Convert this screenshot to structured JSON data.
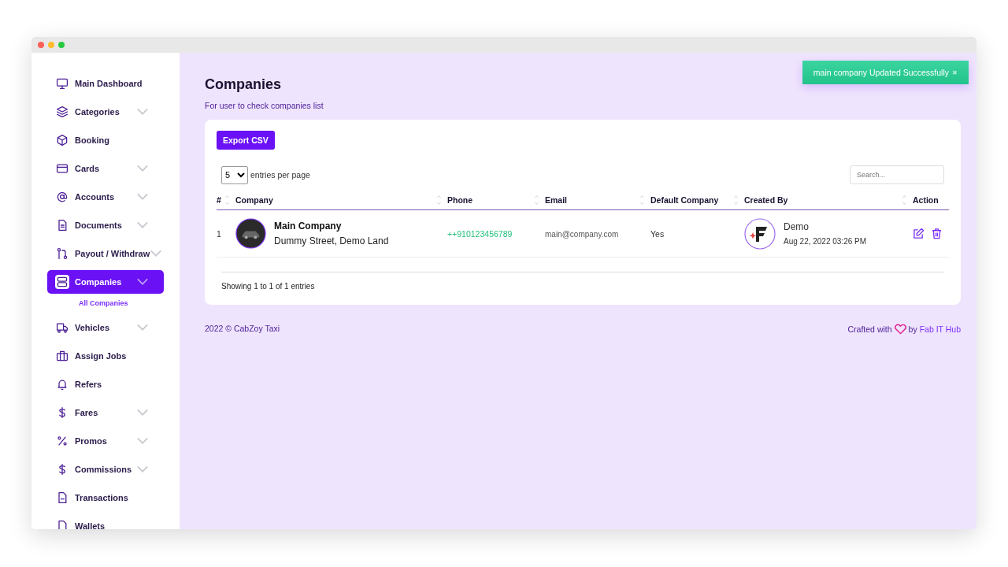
{
  "sidebar": {
    "items": [
      {
        "label": "Main Dashboard",
        "expandable": false,
        "selected": false
      },
      {
        "label": "Categories",
        "expandable": true,
        "selected": false
      },
      {
        "label": "Booking",
        "expandable": false,
        "selected": false
      },
      {
        "label": "Cards",
        "expandable": true,
        "selected": false
      },
      {
        "label": "Accounts",
        "expandable": true,
        "selected": false
      },
      {
        "label": "Documents",
        "expandable": true,
        "selected": false
      },
      {
        "label": "Payout / Withdraw",
        "expandable": true,
        "selected": false
      },
      {
        "label": "Companies",
        "expandable": true,
        "selected": true,
        "children": [
          {
            "label": "All Companies"
          }
        ]
      },
      {
        "label": "Vehicles",
        "expandable": true,
        "selected": false
      },
      {
        "label": "Assign Jobs",
        "expandable": false,
        "selected": false
      },
      {
        "label": "Refers",
        "expandable": false,
        "selected": false
      },
      {
        "label": "Fares",
        "expandable": true,
        "selected": false
      },
      {
        "label": "Promos",
        "expandable": true,
        "selected": false
      },
      {
        "label": "Commissions",
        "expandable": true,
        "selected": false
      },
      {
        "label": "Transactions",
        "expandable": false,
        "selected": false
      },
      {
        "label": "Wallets",
        "expandable": false,
        "selected": false
      }
    ]
  },
  "page": {
    "title": "Companies",
    "subtitle": "For user to check companies list"
  },
  "toast": {
    "message": "main company Updated Successfully",
    "close": "✖"
  },
  "card": {
    "export_button": "Export CSV",
    "page_size": "5",
    "page_size_label": "entries per page",
    "search": {
      "placeholder": "Search..."
    },
    "table": {
      "columns": [
        {
          "label": "#",
          "sortable": true
        },
        {
          "label": "Company",
          "sortable": true
        },
        {
          "label": "Phone",
          "sortable": true
        },
        {
          "label": "Email",
          "sortable": true
        },
        {
          "label": "Default Company",
          "sortable": true
        },
        {
          "label": "Created By",
          "sortable": true
        },
        {
          "label": "Action",
          "sortable": false
        }
      ],
      "rows": [
        {
          "index": "1",
          "company": "Main Company",
          "address": "Dummy Street, Demo Land",
          "phone": "++910123456789",
          "email": "main@company.com",
          "default": "Yes",
          "created_by": "Demo",
          "created_at": "Aug 22, 2022 03:26 PM"
        }
      ]
    },
    "info": "Showing 1 to 1 of 1 entries"
  },
  "footer": {
    "copyright": "2022 © CabZoy Taxi",
    "crafted": "Crafted with",
    "by": "by",
    "author": "Fab IT Hub"
  }
}
